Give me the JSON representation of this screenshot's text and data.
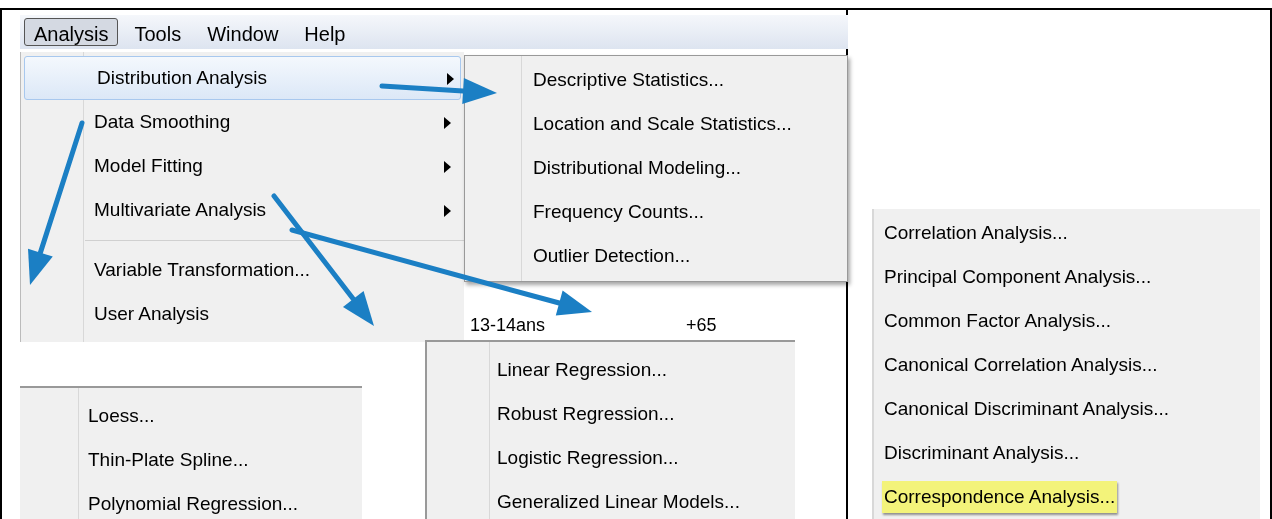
{
  "menu_bar": [
    {
      "label": "Analysis",
      "selected": true
    },
    {
      "label": "Tools",
      "selected": false
    },
    {
      "label": "Window",
      "selected": false
    },
    {
      "label": "Help",
      "selected": false
    }
  ],
  "analysis_menu": [
    {
      "kind": "submenu",
      "label": "Distribution Analysis",
      "selected": true
    },
    {
      "kind": "submenu",
      "label": "Data Smoothing",
      "selected": false
    },
    {
      "kind": "submenu",
      "label": "Model Fitting",
      "selected": false
    },
    {
      "kind": "submenu",
      "label": "Multivariate Analysis",
      "selected": false
    },
    {
      "kind": "separator"
    },
    {
      "kind": "command",
      "label": "Variable Transformation...",
      "selected": false
    },
    {
      "kind": "command",
      "label": "User Analysis",
      "selected": false
    }
  ],
  "distribution_submenu": [
    "Descriptive Statistics...",
    "Location and Scale Statistics...",
    "Distributional Modeling...",
    "Frequency Counts...",
    "Outlier Detection..."
  ],
  "data_table": {
    "rows": [
      [
        "13-14ans",
        "+65"
      ]
    ]
  },
  "model_fitting_submenu": [
    "Linear Regression...",
    "Robust Regression...",
    "Logistic Regression...",
    "Generalized Linear Models..."
  ],
  "data_smoothing_submenu": [
    "Loess...",
    "Thin-Plate Spline...",
    "Polynomial Regression..."
  ],
  "multivariate_submenu": [
    {
      "label": "Correlation Analysis...",
      "selected": false
    },
    {
      "label": "Principal Component Analysis...",
      "selected": false
    },
    {
      "label": "Common Factor Analysis...",
      "selected": false
    },
    {
      "label": "Canonical Correlation Analysis...",
      "selected": false
    },
    {
      "label": "Canonical Discriminant Analysis...",
      "selected": false
    },
    {
      "label": "Discriminant Analysis...",
      "selected": false
    },
    {
      "label": "Correspondence Analysis...",
      "selected": true
    }
  ]
}
